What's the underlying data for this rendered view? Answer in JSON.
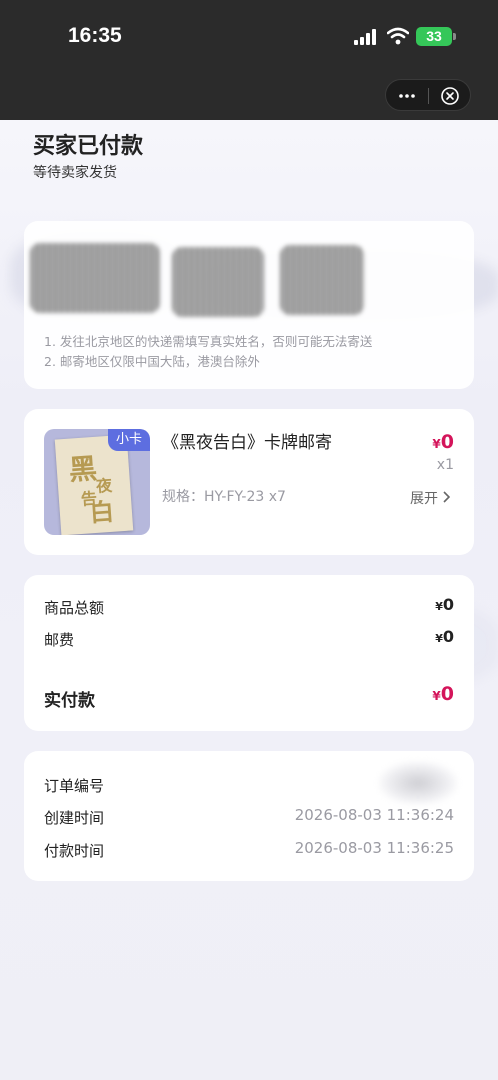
{
  "status_bar": {
    "time": "16:35",
    "battery": "33",
    "icons": [
      "signal-icon",
      "wifi-icon",
      "battery-icon"
    ]
  },
  "capsule": {
    "icons": [
      "more-icon",
      "close-icon"
    ]
  },
  "order_status": {
    "title": "买家已付款",
    "subtitle": "等待卖家发货"
  },
  "address": {
    "notices": [
      "1. 发往北京地区的快递需填写真实姓名，否则可能无法寄送",
      "2. 邮寄地区仅限中国大陆，港澳台除外"
    ]
  },
  "product": {
    "tag": "小卡",
    "name": "《黑夜告白》卡牌邮寄",
    "spec": "规格：HY-FY-23  x7",
    "currency": "¥",
    "price": "0",
    "qty": "x1",
    "expand_label": "展开",
    "thumb_chars": [
      "黑",
      "夜",
      "告",
      "白"
    ]
  },
  "amounts": {
    "goods_total_label": "商品总额",
    "goods_total_value": "0",
    "shipping_label": "邮费",
    "shipping_value": "0",
    "paid_label": "实付款",
    "paid_value": "0",
    "currency": "¥"
  },
  "order_info": {
    "order_no_label": "订单编号",
    "created_label": "创建时间",
    "created_value": "2026-08-03 11:36:24",
    "paid_time_label": "付款时间",
    "paid_time_value": "2026-08-03 11:36:25"
  },
  "colors": {
    "price_red": "#d4145a",
    "tag_blue": "#5d6ee0",
    "battery_green": "#35c759"
  }
}
